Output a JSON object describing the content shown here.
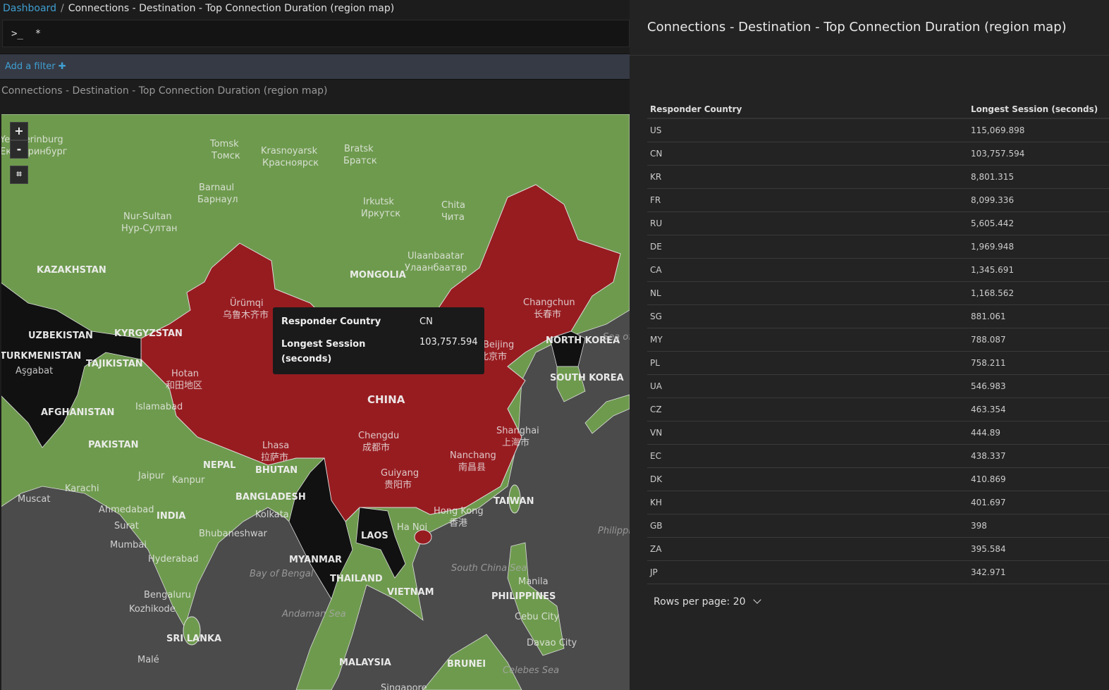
{
  "breadcrumb": {
    "root": "Dashboard",
    "separator": "/",
    "current": "Connections - Destination - Top Connection Duration (region map)"
  },
  "query": {
    "prompt": ">_",
    "value": "*"
  },
  "filter": {
    "add_label": "Add a filter",
    "icon": "plus-icon"
  },
  "visualization": {
    "title": "Connections - Destination - Top Connection Duration (region map)"
  },
  "map": {
    "controls": {
      "zoom_in": "+",
      "zoom_out": "-",
      "crop_icon": "crop-icon"
    },
    "colors": {
      "land": "#6e9a4e",
      "highlight": "#971c20",
      "dark": "#111111",
      "sea": "#4b4b4b"
    },
    "labels": [
      "Yekaterinburg",
      "Екатеринбург",
      "Tomsk",
      "Томск",
      "Krasnoyarsk",
      "Красноярск",
      "Bratsk",
      "Братск",
      "Barnaul",
      "Барнаул",
      "Irkutsk",
      "Иркутск",
      "Chita",
      "Чита",
      "Nur-Sultan",
      "Нур-Султан",
      "Ulaanbaatar",
      "Улаанбаатар",
      "KAZAKHSTAN",
      "MONGOLIA",
      "Ürümqi",
      "乌鲁木齐市",
      "Changchun",
      "长春市",
      "UZBEKISTAN",
      "KYRGYZSTAN",
      "TURKMENISTAN",
      "Aşgabat",
      "TAJIKISTAN",
      "NORTH KOREA",
      "SOUTH KOREA",
      "Hotan",
      "和田地区",
      "Beijing",
      "北京市",
      "CHINA",
      "AFGHANISTAN",
      "Islamabad",
      "PAKISTAN",
      "Chengdu",
      "成都市",
      "Shanghai",
      "上海市",
      "Lhasa",
      "拉萨市",
      "Nanchang",
      "南昌县",
      "Guiyang",
      "贵阳市",
      "NEPAL",
      "BHUTAN",
      "Jaipur",
      "Kanpur",
      "Karachi",
      "Muscat",
      "BANGLADESH",
      "Kolkata",
      "Ahmedabad",
      "INDIA",
      "Surat",
      "Hong Kong",
      "香港",
      "TAIWAN",
      "LAOS",
      "Ha Noi",
      "Bhubaneshwar",
      "Mumbai",
      "MYANMAR",
      "Hyderabad",
      "Bay of Bengal",
      "THAILAND",
      "VIETNAM",
      "South China Sea",
      "Manila",
      "PHILIPPINES",
      "Bengaluru",
      "Kozhikode",
      "Andaman Sea",
      "Cebu City",
      "Davao City",
      "SRI LANKA",
      "Malé",
      "MALAYSIA",
      "BRUNEI",
      "Celebes Sea",
      "Singapore",
      "Sea of Japan",
      "Philippine Sea"
    ]
  },
  "tooltip": {
    "rows": [
      {
        "key": "Responder Country",
        "value": "CN"
      },
      {
        "key": "Longest Session (seconds)",
        "value": "103,757.594"
      }
    ]
  },
  "panel": {
    "title": "Connections - Destination - Top Connection Duration (region map)",
    "columns": [
      "Responder Country",
      "Longest Session (seconds)"
    ],
    "rows": [
      [
        "US",
        "115,069.898"
      ],
      [
        "CN",
        "103,757.594"
      ],
      [
        "KR",
        "8,801.315"
      ],
      [
        "FR",
        "8,099.336"
      ],
      [
        "RU",
        "5,605.442"
      ],
      [
        "DE",
        "1,969.948"
      ],
      [
        "CA",
        "1,345.691"
      ],
      [
        "NL",
        "1,168.562"
      ],
      [
        "SG",
        "881.061"
      ],
      [
        "MY",
        "788.087"
      ],
      [
        "PL",
        "758.211"
      ],
      [
        "UA",
        "546.983"
      ],
      [
        "CZ",
        "463.354"
      ],
      [
        "VN",
        "444.89"
      ],
      [
        "EC",
        "438.337"
      ],
      [
        "DK",
        "410.869"
      ],
      [
        "KH",
        "401.697"
      ],
      [
        "GB",
        "398"
      ],
      [
        "ZA",
        "395.584"
      ],
      [
        "JP",
        "342.971"
      ]
    ],
    "rows_per_page_label": "Rows per page: 20"
  }
}
